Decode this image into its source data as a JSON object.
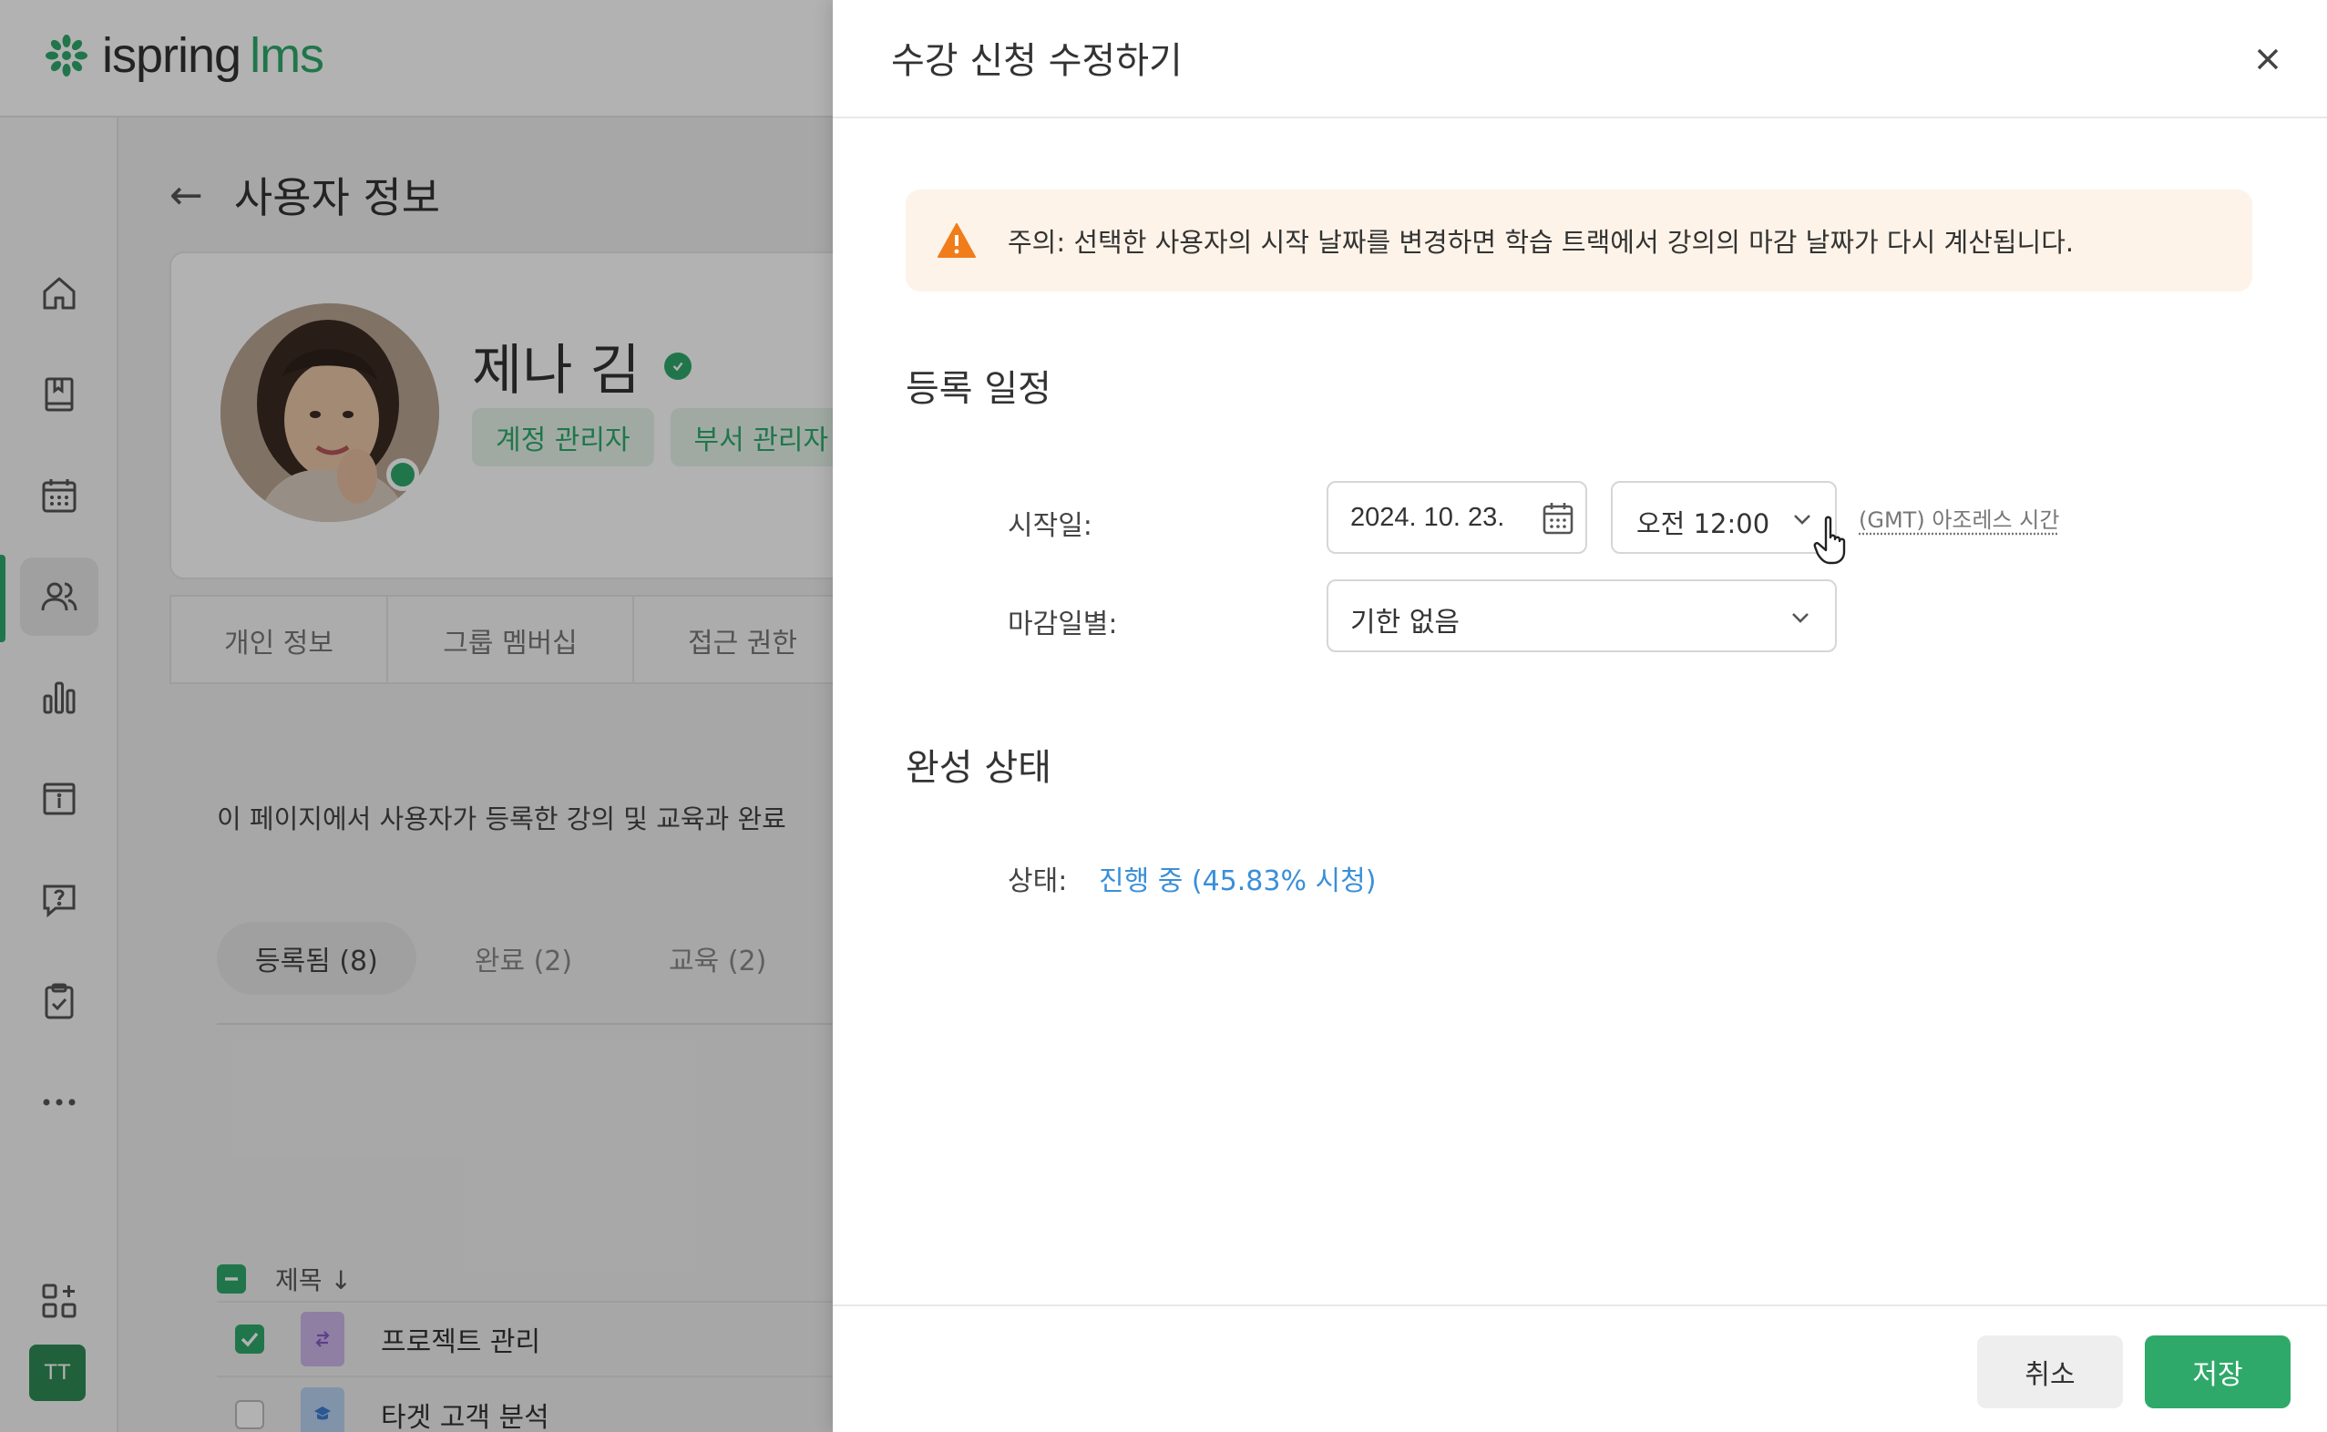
{
  "app": {
    "logo_brand": "ispring",
    "logo_product": "lms"
  },
  "sidebar": {
    "items": [
      {
        "icon": "home-icon"
      },
      {
        "icon": "book-icon"
      },
      {
        "icon": "calendar-icon"
      },
      {
        "icon": "users-icon",
        "active": true
      },
      {
        "icon": "bar-chart-icon"
      },
      {
        "icon": "info-icon"
      },
      {
        "icon": "help-icon"
      },
      {
        "icon": "clipboard-check-icon"
      },
      {
        "icon": "more-icon"
      },
      {
        "icon": "add-widget-icon"
      }
    ],
    "user_initials": "TT"
  },
  "page": {
    "title": "사용자 정보",
    "description": "이 페이지에서 사용자가 등록한 강의 및 교육과 완료"
  },
  "profile": {
    "name": "제나 김",
    "roles": [
      "계정 관리자",
      "부서 관리자"
    ]
  },
  "tabs": [
    "개인 정보",
    "그룹 멤버십",
    "접근 권한"
  ],
  "filters": [
    "등록됨 (8)",
    "완료 (2)",
    "교육 (2)"
  ],
  "table": {
    "header_title": "제목",
    "rows": [
      {
        "title": "프로젝트 관리",
        "checked": true
      },
      {
        "title": "타겟 고객 분석",
        "checked": false
      }
    ]
  },
  "dialog": {
    "title": "수강 신청 수정하기",
    "warning": "주의: 선택한 사용자의 시작 날짜를 변경하면 학습 트랙에서 강의의 마감 날짜가 다시 계산됩니다.",
    "schedule_section": "등록 일정",
    "start_label": "시작일:",
    "start_date": "2024. 10. 23.",
    "start_time": "오전 12:00",
    "timezone": "(GMT) 아조레스 시간",
    "due_label": "마감일별:",
    "due_value": "기한 없음",
    "completion_section": "완성 상태",
    "status_label": "상태:",
    "status_value": "진행 중 (45.83% 시청)",
    "cancel": "취소",
    "save": "저장"
  },
  "colors": {
    "brand_green": "#2fa96a",
    "link_blue": "#3a8fd8",
    "warning_bg": "#fdf3e8",
    "warning_icon": "#f07c1a"
  }
}
